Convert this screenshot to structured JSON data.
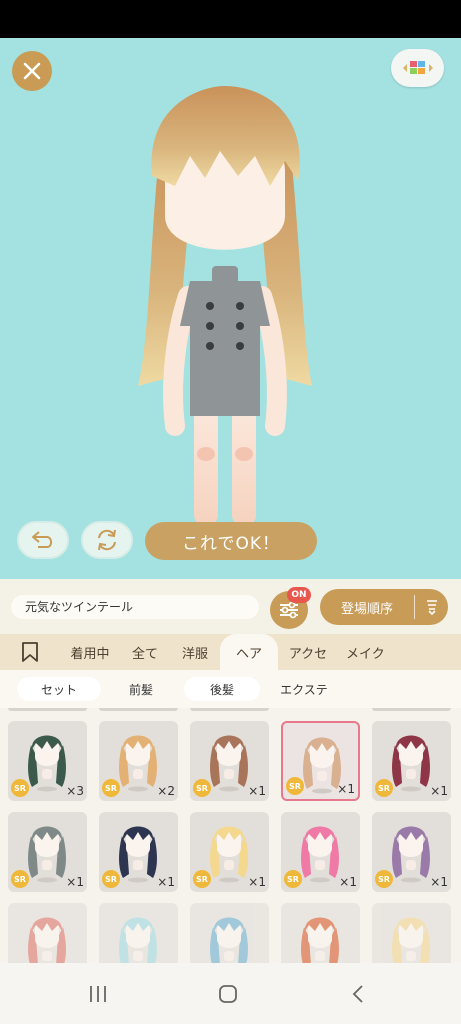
{
  "toolbar": {
    "ok_label": "これでOK！"
  },
  "search": {
    "value": "元気なツインテール"
  },
  "filter": {
    "badge": "ON"
  },
  "sort": {
    "label": "登場順序"
  },
  "tabs": [
    {
      "label": "",
      "icon": "bookmark-icon"
    },
    {
      "label": "着用中"
    },
    {
      "label": "全て"
    },
    {
      "label": "洋服"
    },
    {
      "label": "ヘア",
      "active": true
    },
    {
      "label": "アクセ"
    },
    {
      "label": "メイク"
    }
  ],
  "subtabs": [
    {
      "label": "セット"
    },
    {
      "label": "前髪"
    },
    {
      "label": "後髪"
    },
    {
      "label": "エクステ"
    }
  ],
  "items": [
    {
      "rarity": "SR",
      "count": "×3",
      "hair_color": "#3c5a4c"
    },
    {
      "rarity": "SR",
      "count": "×2",
      "hair_color": "#e4b174"
    },
    {
      "rarity": "SR",
      "count": "×1",
      "hair_color": "#a8745a"
    },
    {
      "rarity": "SR",
      "count": "×1",
      "hair_color": "#d9b090",
      "selected": true
    },
    {
      "rarity": "SR",
      "count": "×1",
      "hair_color": "#8e3648"
    },
    {
      "rarity": "SR",
      "count": "×1",
      "hair_color": "#7f8a88"
    },
    {
      "rarity": "SR",
      "count": "×1",
      "hair_color": "#2d3550"
    },
    {
      "rarity": "SR",
      "count": "×1",
      "hair_color": "#f3d88e"
    },
    {
      "rarity": "SR",
      "count": "×1",
      "hair_color": "#ef7aa6"
    },
    {
      "rarity": "SR",
      "count": "×1",
      "hair_color": "#9a7aa8"
    },
    {
      "rarity": "",
      "count": "",
      "hair_color": "#d9746a"
    },
    {
      "rarity": "",
      "count": "",
      "hair_color": "#9fd7df"
    },
    {
      "rarity": "",
      "count": "",
      "hair_color": "#6aaecf"
    },
    {
      "rarity": "",
      "count": "",
      "hair_color": "#d8572b"
    },
    {
      "rarity": "",
      "count": "",
      "hair_color": "#f1d58f"
    }
  ],
  "colors": {
    "stage_bg": "#a3e2e0",
    "accent_gold": "#c89b57",
    "badge_red": "#e8574e",
    "rarity_yellow": "#f0b83a",
    "selected_border": "#e6798c"
  }
}
